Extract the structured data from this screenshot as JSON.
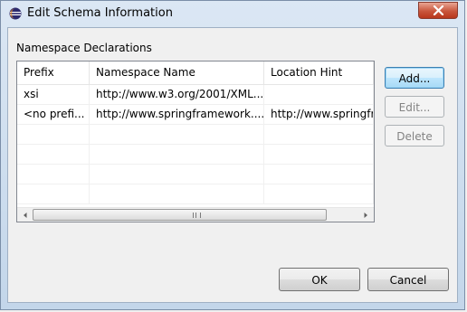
{
  "window": {
    "title": "Edit Schema Information",
    "close_symbol": "close-icon"
  },
  "group_label": "Namespace Declarations",
  "table": {
    "columns": [
      "Prefix",
      "Namespace Name",
      "Location Hint"
    ],
    "rows": [
      [
        "xsi",
        "http://www.w3.org/2001/XML...",
        ""
      ],
      [
        "<no prefi...",
        "http://www.springframework....",
        "http://www.springfra"
      ],
      [
        "",
        "",
        ""
      ],
      [
        "",
        "",
        ""
      ],
      [
        "",
        "",
        ""
      ],
      [
        "",
        "",
        ""
      ]
    ],
    "scrollbar_grip": "III"
  },
  "buttons": {
    "add": "Add...",
    "edit": "Edit...",
    "delete": "Delete",
    "ok": "OK",
    "cancel": "Cancel"
  },
  "colors": {
    "dialog_bg": "#f0f0f0",
    "close_button": "#c9563c",
    "default_button_border": "#3c7fb1"
  }
}
